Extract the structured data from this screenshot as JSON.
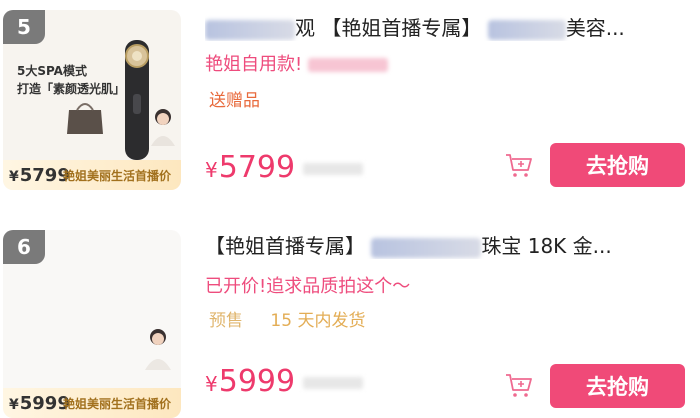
{
  "items": [
    {
      "rank": "5",
      "thumb": {
        "promo_line1": "5大SPA模式",
        "promo_line2": "打造「素颜透光肌」",
        "price_currency": "¥",
        "price": "5799",
        "caption": "艳姐美丽生活首播价"
      },
      "title_prefix_tail": "观",
      "title_exclusive": "【艳姐首播专属】",
      "title_tail": "美容...",
      "subtitle": "艳姐自用款!",
      "tag": "送赠品",
      "price_currency": "¥",
      "price": "5799",
      "buy_label": "去抢购"
    },
    {
      "rank": "6",
      "thumb": {
        "price_currency": "¥",
        "price": "5999",
        "caption": "艳姐美丽生活首播价"
      },
      "title_exclusive": "【艳姐首播专属】",
      "title_tail": "珠宝 18K 金...",
      "subtitle": "已开价!追求品质拍这个～",
      "tag_presale": "预售",
      "tag_ship": "15 天内发货",
      "price_currency": "¥",
      "price": "5999",
      "buy_label": "去抢购"
    }
  ],
  "colors": {
    "accent_pink": "#ee3a6c",
    "buy_button": "#f04a78",
    "rank_badge": "#7a7a7a",
    "tag_orange": "#e86a3c",
    "tag_gold": "#e0b66e"
  },
  "icons": {
    "cart": "shopping-cart-plus-icon"
  }
}
